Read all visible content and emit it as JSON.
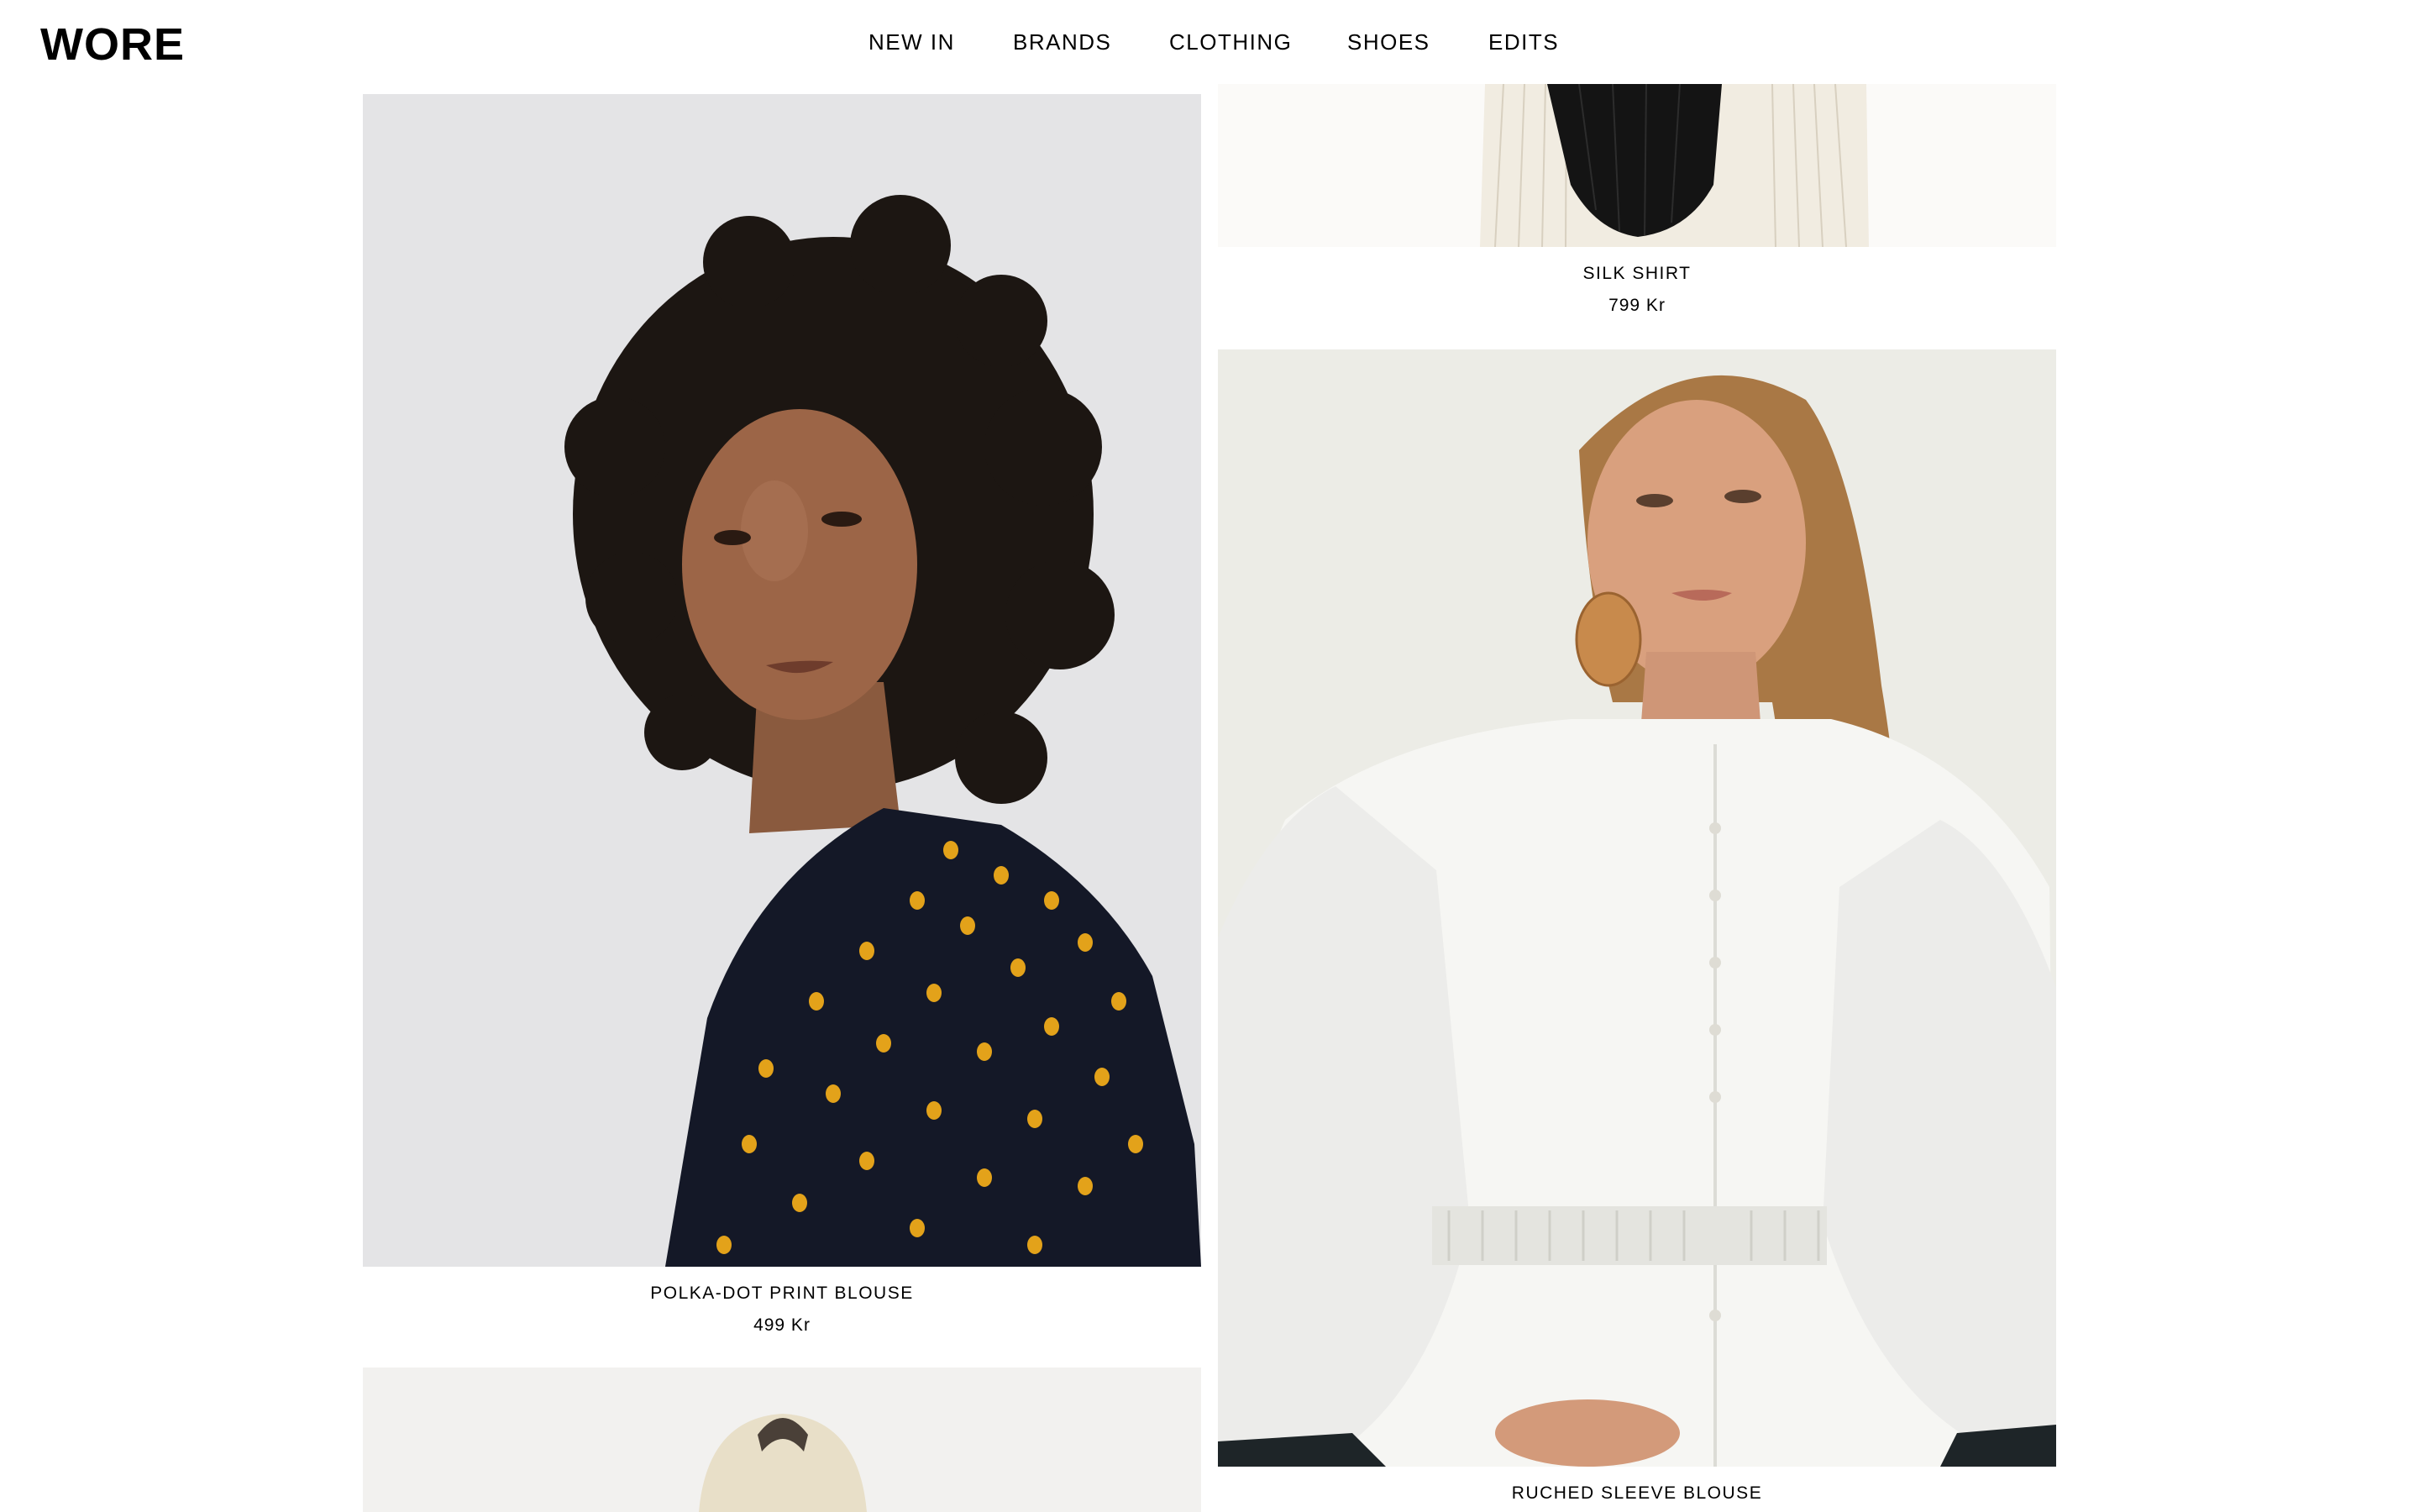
{
  "brand": {
    "logo": "WORE"
  },
  "nav": {
    "items": [
      {
        "label": "NEW IN"
      },
      {
        "label": "BRANDS"
      },
      {
        "label": "CLOTHING"
      },
      {
        "label": "SHOES"
      },
      {
        "label": "EDITS"
      }
    ]
  },
  "products": [
    {
      "name": "SILK SHIRT",
      "price": "799 Kr"
    },
    {
      "name": "POLKA-DOT PRINT BLOUSE",
      "price": "499 Kr"
    },
    {
      "name": "RUCHED SLEEVE BLOUSE",
      "price": ""
    }
  ]
}
